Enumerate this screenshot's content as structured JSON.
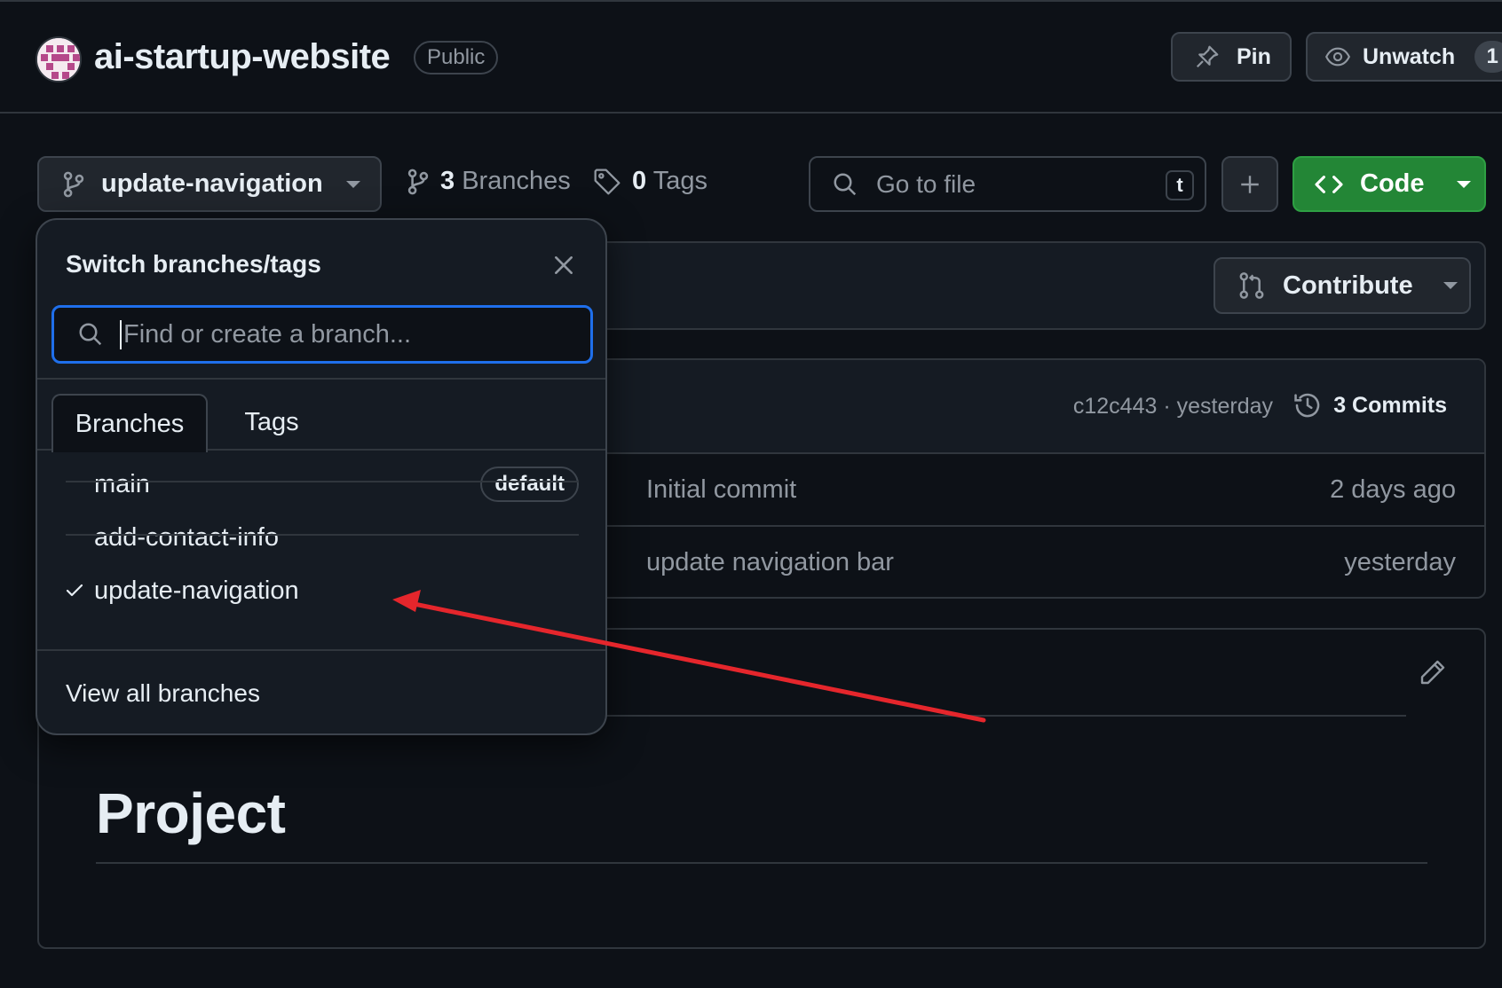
{
  "repo": {
    "name": "ai-startup-website",
    "visibility": "Public"
  },
  "header": {
    "pin_label": "Pin",
    "watch_label": "Unwatch",
    "watch_count": "1"
  },
  "toolbar": {
    "current_branch": "update-navigation",
    "branches_count": "3",
    "branches_label": "Branches",
    "tags_count": "0",
    "tags_label": "Tags",
    "goto_placeholder": "Go to file",
    "goto_shortcut": "t",
    "code_label": "Code"
  },
  "contribute": {
    "label": "Contribute"
  },
  "latest_commit": {
    "meta": "c12c443 · yesterday",
    "commits_label": "3 Commits"
  },
  "files": [
    {
      "message": "Initial commit",
      "when": "2 days ago"
    },
    {
      "message": "update navigation bar",
      "when": "yesterday"
    }
  ],
  "readme": {
    "heading": "Project"
  },
  "dropdown": {
    "title": "Switch branches/tags",
    "search_placeholder": "Find or create a branch...",
    "tabs": [
      "Branches",
      "Tags"
    ],
    "active_tab": "Branches",
    "branches": [
      {
        "name": "main",
        "badge": "default",
        "selected": false
      },
      {
        "name": "add-contact-info",
        "badge": "",
        "selected": false
      },
      {
        "name": "update-navigation",
        "badge": "",
        "selected": true
      }
    ],
    "footer_link": "View all branches"
  },
  "colors": {
    "background": "#0d1117",
    "accent_blue": "#1f6feb",
    "code_green": "#238636",
    "annotation_red": "#e5262c"
  },
  "icons": [
    "avatar-identicon",
    "pin-icon",
    "eye-icon",
    "git-branch-icon",
    "tag-icon",
    "search-icon",
    "plus-icon",
    "code-icon",
    "git-pull-request-icon",
    "history-icon",
    "pencil-icon",
    "close-icon",
    "check-icon",
    "annotation-arrow"
  ]
}
